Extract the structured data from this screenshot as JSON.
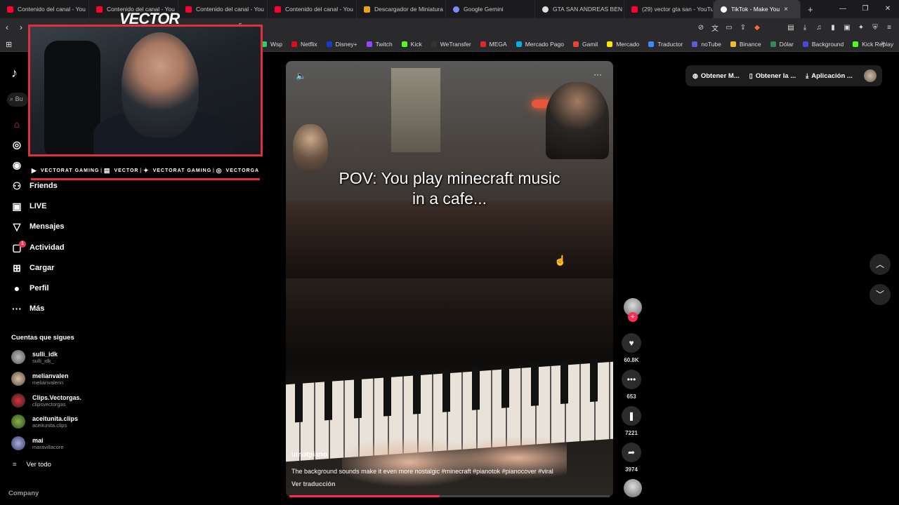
{
  "browser": {
    "tabs": [
      {
        "label": "Contenido del canal - You",
        "color": "#ff0033"
      },
      {
        "label": "Contenido del canal - You",
        "color": "#ff0033"
      },
      {
        "label": "Contenido del canal - You",
        "color": "#ff0033"
      },
      {
        "label": "Contenido del canal - You",
        "color": "#ff0033"
      },
      {
        "label": "Descargador de Miniatura",
        "color": "#e8a317"
      },
      {
        "label": "Google Gemini",
        "color": "#7a8cff"
      },
      {
        "label": "GTA SAN ANDREAS BEN 1",
        "color": "#e0e0e0"
      },
      {
        "label": "(29) vector gta san - YouTu",
        "color": "#ff0033"
      },
      {
        "label": "TikTok - Make You",
        "color": "#ffffff"
      }
    ],
    "new_tab": "+",
    "close_tab": "×",
    "window_controls": [
      "—",
      "❐",
      "✕"
    ],
    "url_fragment": "s",
    "bookmarks": [
      {
        "label": "Wsp",
        "color": "#25d366"
      },
      {
        "label": "Netflix",
        "color": "#e50914"
      },
      {
        "label": "Disney+",
        "color": "#113ccf"
      },
      {
        "label": "Twitch",
        "color": "#9146ff"
      },
      {
        "label": "Kick",
        "color": "#53fc18"
      },
      {
        "label": "WeTransfer",
        "color": "#333333"
      },
      {
        "label": "MEGA",
        "color": "#d9272e"
      },
      {
        "label": "Mercado Pago",
        "color": "#00b1ea"
      },
      {
        "label": "Gamil",
        "color": "#ea4335"
      },
      {
        "label": "Mercado",
        "color": "#ffe600"
      },
      {
        "label": "Traductor",
        "color": "#4285f4"
      },
      {
        "label": "noTube",
        "color": "#5b5bd6"
      },
      {
        "label": "Binance",
        "color": "#f3ba2f"
      },
      {
        "label": "Dólar",
        "color": "#2e8b57"
      },
      {
        "label": "Background",
        "color": "#4a4ad8"
      },
      {
        "label": "Kick Replay",
        "color": "#53fc18"
      }
    ]
  },
  "tiktok": {
    "search_placeholder": "Bu",
    "nav": {
      "friends": "Friends",
      "live": "LIVE",
      "messages": "Mensajes",
      "activity": "Actividad",
      "activity_badge": "1",
      "upload": "Cargar",
      "profile": "Perfil",
      "more": "Más"
    },
    "following_title": "Cuentas que sigues",
    "following": [
      {
        "name": "sulli_idk",
        "handle": "sulli_idk_"
      },
      {
        "name": "melianvalen",
        "handle": "melianvalenn"
      },
      {
        "name": "Clips.Vectorgas.",
        "handle": "clipsvectorgas"
      },
      {
        "name": "aceitunita.clips",
        "handle": "aceitunita.clips"
      },
      {
        "name": "mai",
        "handle": "maravillacore"
      }
    ],
    "see_all": "Ver todo",
    "company": "Company",
    "top_right": {
      "item1": "Obtener M...",
      "item2": "Obtener la ...",
      "item3": "Aplicación ..."
    },
    "video": {
      "caption_line1": "POV: You play minecraft music",
      "caption_line2": "in a cafe...",
      "username": "umutpiano",
      "description": "The background sounds make it even more nostalgic #minecraft #pianotok #pianocover #viral",
      "translate": "Ver traducción",
      "progress": 0.47,
      "likes": "60.8K",
      "comments": "653",
      "saves": "7221",
      "shares": "3974"
    }
  },
  "overlay": {
    "streamer_name": "VECTOR",
    "socials": [
      {
        "icon": "youtube-icon",
        "label": "VECTORAT GAMING"
      },
      {
        "icon": "twitch-icon",
        "label": "VECTOR"
      },
      {
        "icon": "twitter-icon",
        "label": "VECTORAT GAMING"
      },
      {
        "icon": "instagram-icon",
        "label": "VECTORGA"
      }
    ]
  }
}
